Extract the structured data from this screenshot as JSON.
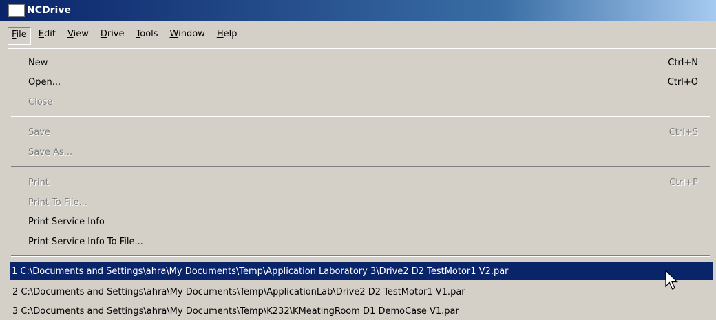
{
  "window": {
    "title": "NCDrive"
  },
  "menubar": {
    "items": [
      {
        "accel": "F",
        "rest": "ile"
      },
      {
        "accel": "E",
        "rest": "dit"
      },
      {
        "accel": "V",
        "rest": "iew"
      },
      {
        "accel": "D",
        "rest": "rive"
      },
      {
        "accel": "T",
        "rest": "ools"
      },
      {
        "accel": "W",
        "rest": "indow"
      },
      {
        "accel": "H",
        "rest": "elp"
      }
    ]
  },
  "file_menu": {
    "new": {
      "label": "New",
      "shortcut": "Ctrl+N"
    },
    "open": {
      "label": "Open...",
      "shortcut": "Ctrl+O"
    },
    "close": {
      "label": "Close"
    },
    "save": {
      "label": "Save",
      "shortcut": "Ctrl+S"
    },
    "save_as": {
      "label": "Save As..."
    },
    "print": {
      "label": "Print",
      "shortcut": "Ctrl+P"
    },
    "print_to_file": {
      "label": "Print To File..."
    },
    "print_service_info": {
      "label": "Print Service Info"
    },
    "print_service_info_to_file": {
      "label": "Print Service Info To File..."
    },
    "recent_files": [
      "1 C:\\Documents and Settings\\ahra\\My Documents\\Temp\\Application Laboratory 3\\Drive2 D2 TestMotor1 V2.par",
      "2 C:\\Documents and Settings\\ahra\\My Documents\\Temp\\ApplicationLab\\Drive2 D2 TestMotor1 V1.par",
      "3 C:\\Documents and Settings\\ahra\\My Documents\\Temp\\K232\\KMeatingRoom D1 DemoCase V1.par"
    ]
  },
  "colors": {
    "title_gradient_start": "#0a246a",
    "title_gradient_end": "#a6caf0",
    "highlight": "#0a246a",
    "face": "#d4d0c8",
    "disabled_text": "#808080"
  }
}
